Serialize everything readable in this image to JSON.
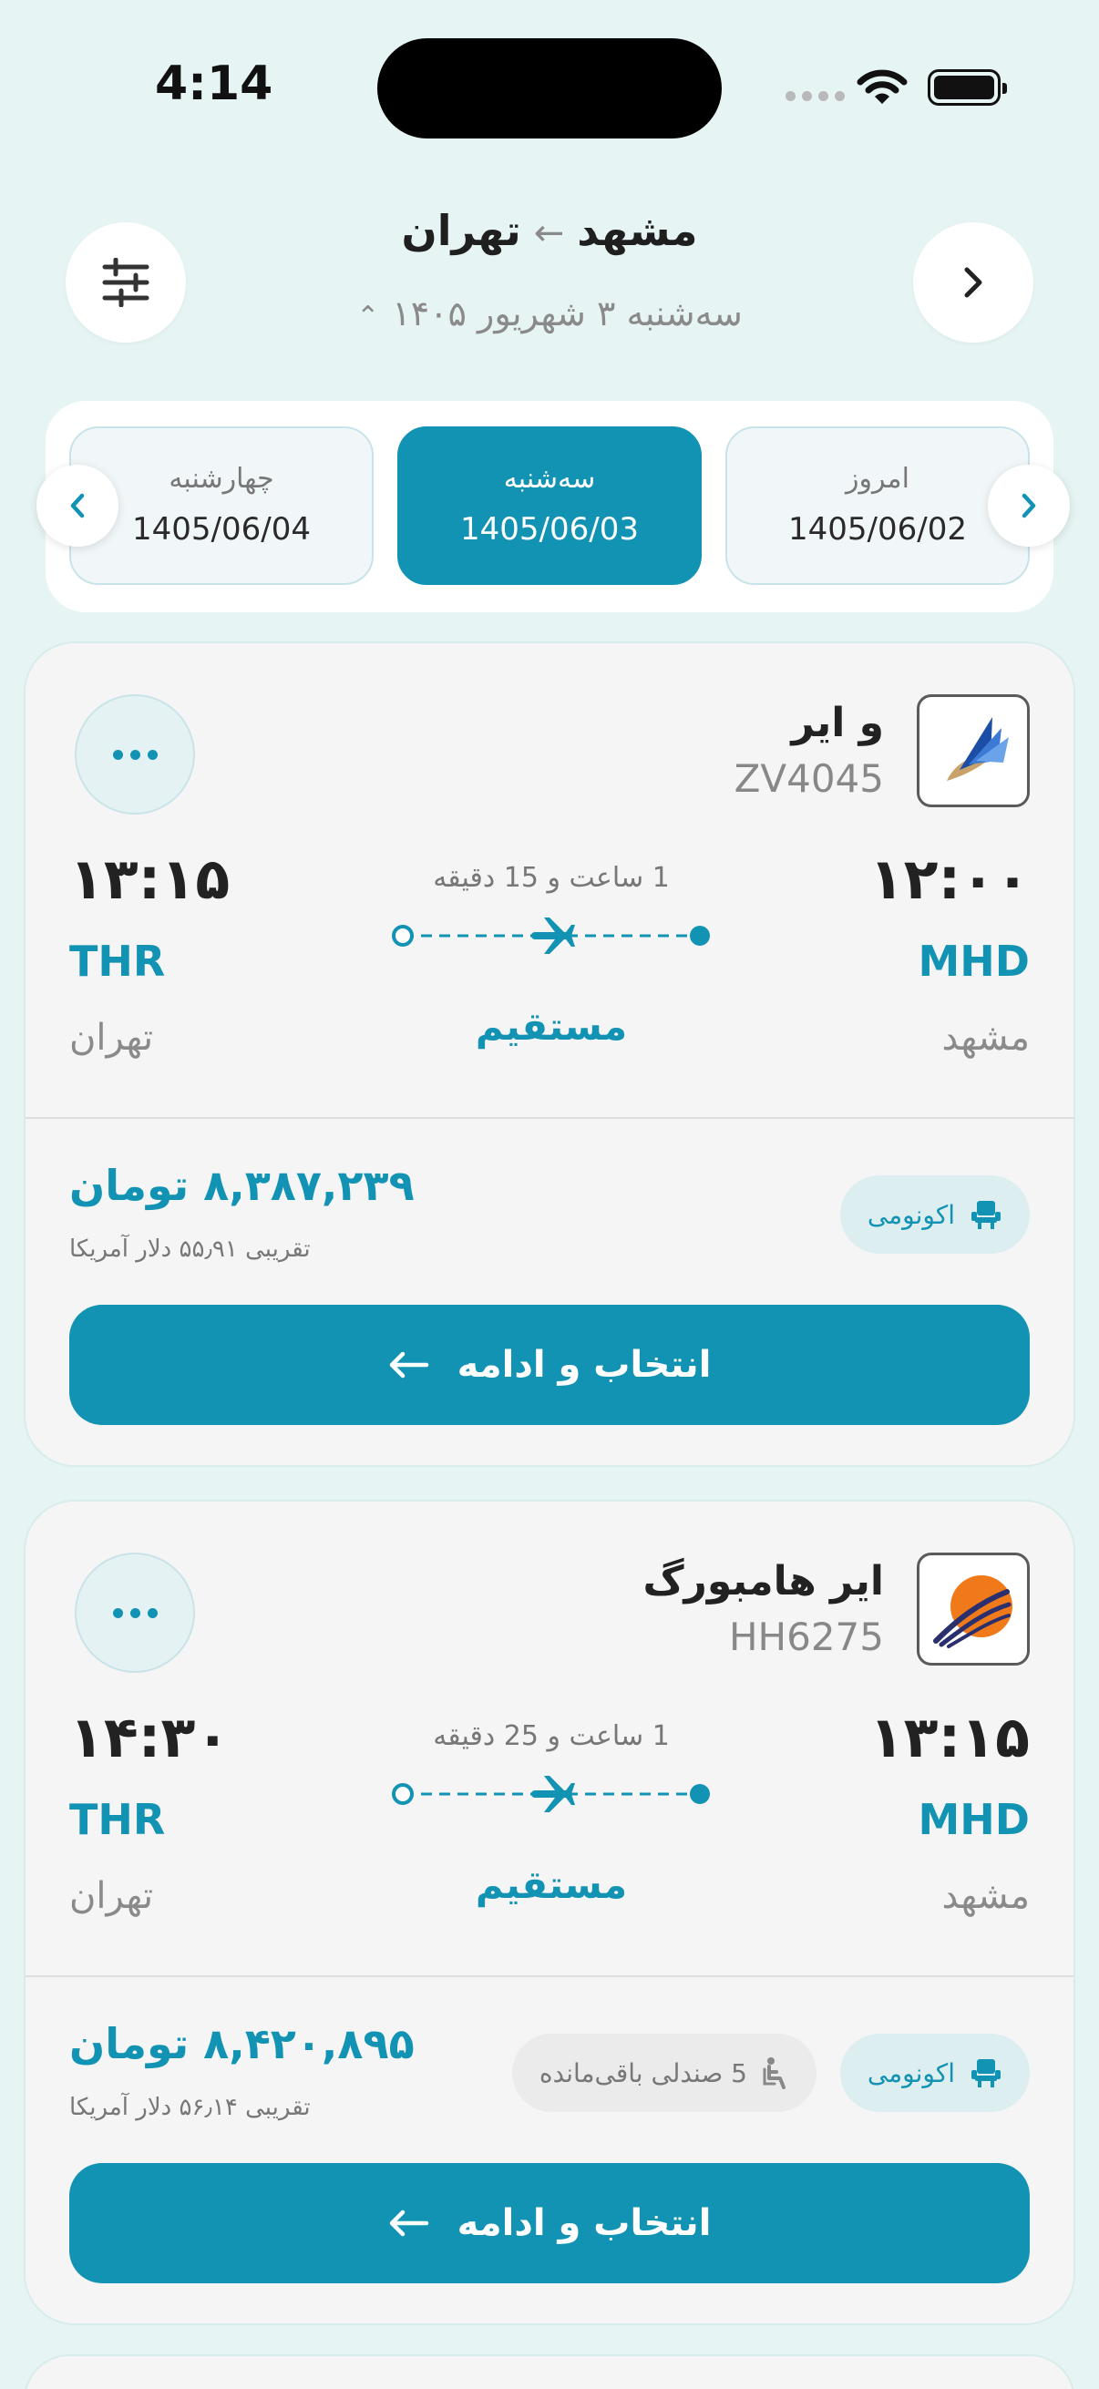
{
  "status": {
    "time": "4:14"
  },
  "header": {
    "origin": "مشهد",
    "destination": "تهران",
    "date_text": "سه‌شنبه ۳ شهریور ۱۴۰۵"
  },
  "date_strip": [
    {
      "day": "چهارشنبه",
      "date": "1405/06/04",
      "selected": false
    },
    {
      "day": "سه‌شنبه",
      "date": "1405/06/03",
      "selected": true
    },
    {
      "day": "امروز",
      "date": "1405/06/02",
      "selected": false
    }
  ],
  "flights": [
    {
      "airline": "و ایر",
      "flight_no": "ZV4045",
      "dep_time": "۱۲:۰۰",
      "arr_time": "۱۳:۱۵",
      "dep_code": "MHD",
      "arr_code": "THR",
      "dep_city": "مشهد",
      "arr_city": "تهران",
      "duration": "1 ساعت و 15 دقیقه",
      "stops": "مستقیم",
      "price": "۸,۳۸۷,۲۳۹ تومان",
      "price_usd": "تقریبی ۵۵٫۹۱ دلار آمریکا",
      "cabin": "اکونومی",
      "seats_left": "",
      "cta": "انتخاب و ادامه"
    },
    {
      "airline": "ایر هامبورگ",
      "flight_no": "HH6275",
      "dep_time": "۱۳:۱۵",
      "arr_time": "۱۴:۳۰",
      "dep_code": "MHD",
      "arr_code": "THR",
      "dep_city": "مشهد",
      "arr_city": "تهران",
      "duration": "1 ساعت و 25 دقیقه",
      "stops": "مستقیم",
      "price": "۸,۴۲۰,۸۹۵ تومان",
      "price_usd": "تقریبی ۵۶٫۱۴ دلار آمریکا",
      "cabin": "اکونومی",
      "seats_left": "5 صندلی باقی‌مانده",
      "cta": "انتخاب و ادامه"
    }
  ],
  "colors": {
    "accent": "#1393b4",
    "background": "#e6f4f3",
    "card": "#f5f5f5"
  }
}
